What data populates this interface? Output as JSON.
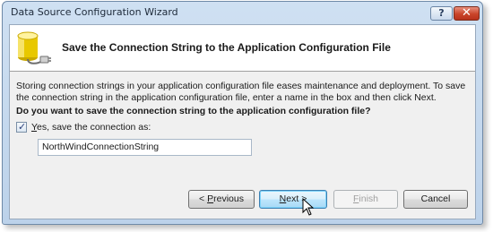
{
  "window": {
    "title": "Data Source Configuration Wizard",
    "help_label": "?",
    "close_label": "✕"
  },
  "header": {
    "icon": "database-connection-icon",
    "title": "Save the Connection String to the Application Configuration File"
  },
  "body": {
    "description": "Storing connection strings in your application configuration file eases maintenance and deployment. To save the connection string in the application configuration file, enter a name in the box and then click Next.",
    "question": "Do you want to save the connection string to the application configuration file?",
    "save_checkbox": {
      "checked": true,
      "mnemonic": "Y",
      "label_rest": "es, save the connection as:"
    },
    "connection_name": "NorthWindConnectionString"
  },
  "buttons": {
    "previous": {
      "prefix": "< ",
      "mnemonic": "P",
      "rest": "revious"
    },
    "next": {
      "mnemonic": "N",
      "rest": "ext >"
    },
    "finish": {
      "mnemonic": "F",
      "rest": "inish",
      "enabled": false
    },
    "cancel": "Cancel"
  },
  "colors": {
    "titlebar": "#c5d9ee",
    "close_button": "#c9442a",
    "default_button_border": "#3c7fb1"
  }
}
